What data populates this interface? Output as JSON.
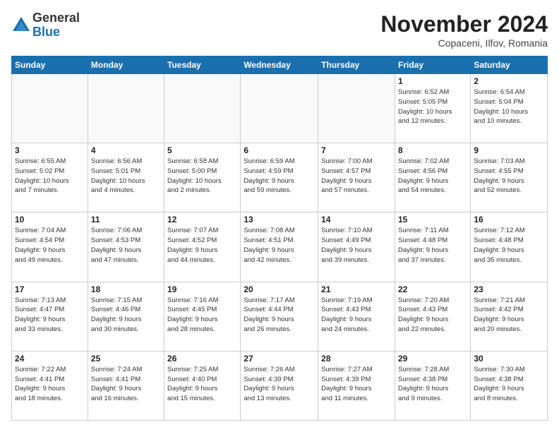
{
  "logo": {
    "general": "General",
    "blue": "Blue"
  },
  "title": "November 2024",
  "location": "Copaceni, Ilfov, Romania",
  "weekdays": [
    "Sunday",
    "Monday",
    "Tuesday",
    "Wednesday",
    "Thursday",
    "Friday",
    "Saturday"
  ],
  "weeks": [
    [
      {
        "day": "",
        "info": ""
      },
      {
        "day": "",
        "info": ""
      },
      {
        "day": "",
        "info": ""
      },
      {
        "day": "",
        "info": ""
      },
      {
        "day": "",
        "info": ""
      },
      {
        "day": "1",
        "info": "Sunrise: 6:52 AM\nSunset: 5:05 PM\nDaylight: 10 hours\nand 12 minutes."
      },
      {
        "day": "2",
        "info": "Sunrise: 6:54 AM\nSunset: 5:04 PM\nDaylight: 10 hours\nand 10 minutes."
      }
    ],
    [
      {
        "day": "3",
        "info": "Sunrise: 6:55 AM\nSunset: 5:02 PM\nDaylight: 10 hours\nand 7 minutes."
      },
      {
        "day": "4",
        "info": "Sunrise: 6:56 AM\nSunset: 5:01 PM\nDaylight: 10 hours\nand 4 minutes."
      },
      {
        "day": "5",
        "info": "Sunrise: 6:58 AM\nSunset: 5:00 PM\nDaylight: 10 hours\nand 2 minutes."
      },
      {
        "day": "6",
        "info": "Sunrise: 6:59 AM\nSunset: 4:59 PM\nDaylight: 9 hours\nand 59 minutes."
      },
      {
        "day": "7",
        "info": "Sunrise: 7:00 AM\nSunset: 4:57 PM\nDaylight: 9 hours\nand 57 minutes."
      },
      {
        "day": "8",
        "info": "Sunrise: 7:02 AM\nSunset: 4:56 PM\nDaylight: 9 hours\nand 54 minutes."
      },
      {
        "day": "9",
        "info": "Sunrise: 7:03 AM\nSunset: 4:55 PM\nDaylight: 9 hours\nand 52 minutes."
      }
    ],
    [
      {
        "day": "10",
        "info": "Sunrise: 7:04 AM\nSunset: 4:54 PM\nDaylight: 9 hours\nand 49 minutes."
      },
      {
        "day": "11",
        "info": "Sunrise: 7:06 AM\nSunset: 4:53 PM\nDaylight: 9 hours\nand 47 minutes."
      },
      {
        "day": "12",
        "info": "Sunrise: 7:07 AM\nSunset: 4:52 PM\nDaylight: 9 hours\nand 44 minutes."
      },
      {
        "day": "13",
        "info": "Sunrise: 7:08 AM\nSunset: 4:51 PM\nDaylight: 9 hours\nand 42 minutes."
      },
      {
        "day": "14",
        "info": "Sunrise: 7:10 AM\nSunset: 4:49 PM\nDaylight: 9 hours\nand 39 minutes."
      },
      {
        "day": "15",
        "info": "Sunrise: 7:11 AM\nSunset: 4:48 PM\nDaylight: 9 hours\nand 37 minutes."
      },
      {
        "day": "16",
        "info": "Sunrise: 7:12 AM\nSunset: 4:48 PM\nDaylight: 9 hours\nand 35 minutes."
      }
    ],
    [
      {
        "day": "17",
        "info": "Sunrise: 7:13 AM\nSunset: 4:47 PM\nDaylight: 9 hours\nand 33 minutes."
      },
      {
        "day": "18",
        "info": "Sunrise: 7:15 AM\nSunset: 4:46 PM\nDaylight: 9 hours\nand 30 minutes."
      },
      {
        "day": "19",
        "info": "Sunrise: 7:16 AM\nSunset: 4:45 PM\nDaylight: 9 hours\nand 28 minutes."
      },
      {
        "day": "20",
        "info": "Sunrise: 7:17 AM\nSunset: 4:44 PM\nDaylight: 9 hours\nand 26 minutes."
      },
      {
        "day": "21",
        "info": "Sunrise: 7:19 AM\nSunset: 4:43 PM\nDaylight: 9 hours\nand 24 minutes."
      },
      {
        "day": "22",
        "info": "Sunrise: 7:20 AM\nSunset: 4:43 PM\nDaylight: 9 hours\nand 22 minutes."
      },
      {
        "day": "23",
        "info": "Sunrise: 7:21 AM\nSunset: 4:42 PM\nDaylight: 9 hours\nand 20 minutes."
      }
    ],
    [
      {
        "day": "24",
        "info": "Sunrise: 7:22 AM\nSunset: 4:41 PM\nDaylight: 9 hours\nand 18 minutes."
      },
      {
        "day": "25",
        "info": "Sunrise: 7:24 AM\nSunset: 4:41 PM\nDaylight: 9 hours\nand 16 minutes."
      },
      {
        "day": "26",
        "info": "Sunrise: 7:25 AM\nSunset: 4:40 PM\nDaylight: 9 hours\nand 15 minutes."
      },
      {
        "day": "27",
        "info": "Sunrise: 7:26 AM\nSunset: 4:39 PM\nDaylight: 9 hours\nand 13 minutes."
      },
      {
        "day": "28",
        "info": "Sunrise: 7:27 AM\nSunset: 4:39 PM\nDaylight: 9 hours\nand 11 minutes."
      },
      {
        "day": "29",
        "info": "Sunrise: 7:28 AM\nSunset: 4:38 PM\nDaylight: 9 hours\nand 9 minutes."
      },
      {
        "day": "30",
        "info": "Sunrise: 7:30 AM\nSunset: 4:38 PM\nDaylight: 9 hours\nand 8 minutes."
      }
    ]
  ]
}
